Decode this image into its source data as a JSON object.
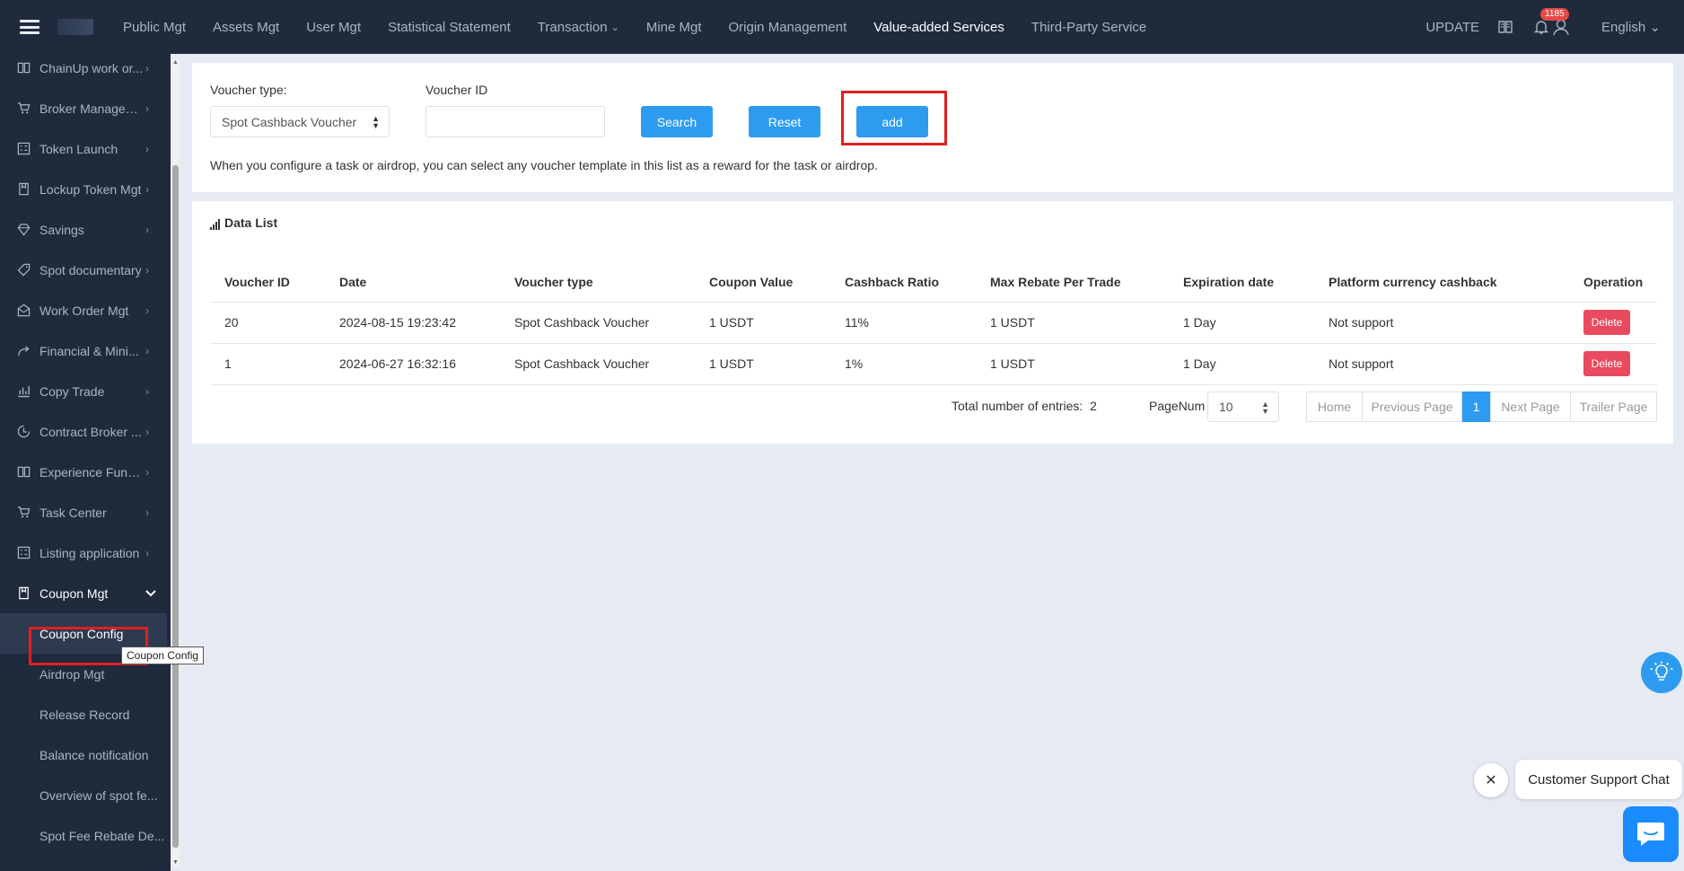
{
  "topnav": {
    "items": [
      {
        "label": "Public Mgt"
      },
      {
        "label": "Assets Mgt"
      },
      {
        "label": "User Mgt"
      },
      {
        "label": "Statistical Statement"
      },
      {
        "label": "Transaction"
      },
      {
        "label": "Mine Mgt"
      },
      {
        "label": "Origin Management"
      },
      {
        "label": "Value-added Services"
      },
      {
        "label": "Third-Party Service"
      }
    ],
    "update_label": "UPDATE",
    "notification_count": "1185",
    "language": "English"
  },
  "sidebar": {
    "items": [
      {
        "label": "ChainUp work or...",
        "icon": "book-icon"
      },
      {
        "label": "Broker Managem...",
        "icon": "cart-icon"
      },
      {
        "label": "Token Launch",
        "icon": "grid-icon"
      },
      {
        "label": "Lockup Token Mgt",
        "icon": "doc-icon"
      },
      {
        "label": "Savings",
        "icon": "diamond-icon"
      },
      {
        "label": "Spot documentary",
        "icon": "tag-icon"
      },
      {
        "label": "Work Order Mgt",
        "icon": "mail-icon"
      },
      {
        "label": "Financial & Mini...",
        "icon": "share-icon"
      },
      {
        "label": "Copy Trade",
        "icon": "chart-icon"
      },
      {
        "label": "Contract Broker ...",
        "icon": "clock-icon"
      },
      {
        "label": "Experience Fundi...",
        "icon": "book-icon"
      },
      {
        "label": "Task Center",
        "icon": "cart-icon"
      },
      {
        "label": "Listing application",
        "icon": "grid-icon"
      },
      {
        "label": "Coupon Mgt",
        "icon": "doc-icon"
      }
    ],
    "subitems": [
      {
        "label": "Coupon Config"
      },
      {
        "label": "Airdrop Mgt"
      },
      {
        "label": "Release Record"
      },
      {
        "label": "Balance notification"
      },
      {
        "label": "Overview of spot fe..."
      },
      {
        "label": "Spot Fee Rebate De..."
      }
    ],
    "tooltip": "Coupon Config"
  },
  "filter": {
    "voucher_type_label": "Voucher type:",
    "voucher_type_value": "Spot Cashback Voucher",
    "voucher_id_label": "Voucher ID",
    "voucher_id_value": "",
    "search_label": "Search",
    "reset_label": "Reset",
    "add_label": "add",
    "hint": "When you configure a task or airdrop, you can select any voucher template in this list as a reward for the task or airdrop."
  },
  "datalist": {
    "title": "Data List",
    "columns": [
      "Voucher ID",
      "Date",
      "Voucher type",
      "Coupon Value",
      "Cashback Ratio",
      "Max Rebate Per Trade",
      "Expiration date",
      "Platform currency cashback",
      "Operation"
    ],
    "rows": [
      {
        "id": "20",
        "date": "2024-08-15 19:23:42",
        "type": "Spot Cashback Voucher",
        "value": "1 USDT",
        "ratio": "11%",
        "max_rebate": "1 USDT",
        "expiration": "1 Day",
        "platform_cashback": "Not support",
        "action": "Delete"
      },
      {
        "id": "1",
        "date": "2024-06-27 16:32:16",
        "type": "Spot Cashback Voucher",
        "value": "1 USDT",
        "ratio": "1%",
        "max_rebate": "1 USDT",
        "expiration": "1 Day",
        "platform_cashback": "Not support",
        "action": "Delete"
      }
    ],
    "total_label": "Total number of entries:",
    "total_value": "2",
    "pagenum_label": "PageNum",
    "pagenum_value": "10",
    "pager": {
      "home": "Home",
      "prev": "Previous Page",
      "current": "1",
      "next": "Next Page",
      "last": "Trailer Page"
    }
  },
  "widgets": {
    "chat_label": "Customer Support Chat"
  },
  "colors": {
    "nav_bg": "#1f2a3c",
    "accent": "#2d9cf0",
    "danger": "#e84a5f",
    "highlight": "#e02020"
  }
}
